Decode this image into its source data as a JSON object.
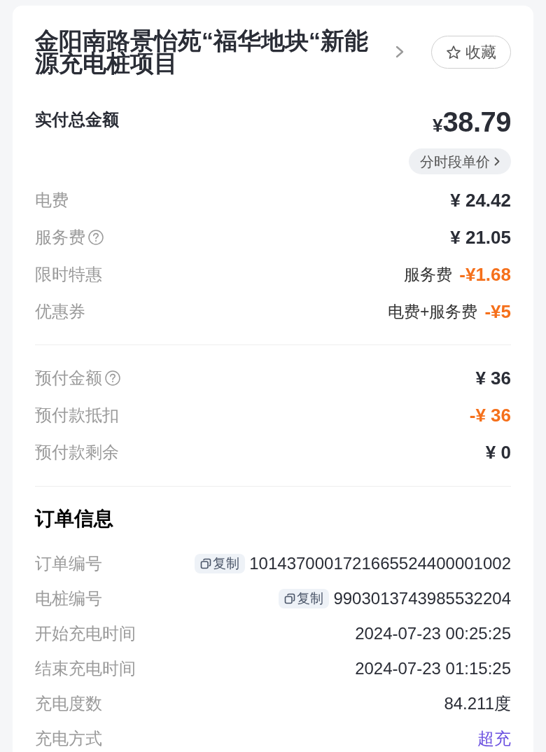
{
  "header": {
    "title": "金阳南路景怡苑“福华地块“新能源充电桩项目",
    "favorite_button": "收藏"
  },
  "total": {
    "label": "实付总金额",
    "currency": "¥",
    "amount": "38.79",
    "price_button": "分时段单价"
  },
  "fees": [
    {
      "label": "电费",
      "help": false,
      "kind": "charge",
      "value": "¥ 24.42"
    },
    {
      "label": "服务费",
      "help": true,
      "kind": "charge",
      "value": "¥ 21.05"
    },
    {
      "label": "限时特惠",
      "help": false,
      "kind": "discount",
      "note": "服务费",
      "value": "-¥1.68"
    },
    {
      "label": "优惠券",
      "help": false,
      "kind": "discount",
      "note": "电费+服务费",
      "value": "-¥5"
    }
  ],
  "prepay": [
    {
      "label": "预付金额",
      "help": true,
      "kind": "charge",
      "value": "¥ 36"
    },
    {
      "label": "预付款抵扣",
      "help": false,
      "kind": "discount",
      "value": "-¥ 36"
    },
    {
      "label": "预付款剩余",
      "help": false,
      "kind": "charge",
      "value": "¥ 0"
    }
  ],
  "order_info": {
    "title": "订单信息",
    "rows": [
      {
        "label": "订单编号",
        "kind": "copyable",
        "copy_button": "复制",
        "value": "1014370001721665524400001002"
      },
      {
        "label": "电桩编号",
        "kind": "copyable",
        "copy_button": "复制",
        "value": "9903013743985532204"
      },
      {
        "label": "开始充电时间",
        "kind": "plain",
        "value": "2024-07-23 00:25:25"
      },
      {
        "label": "结束充电时间",
        "kind": "plain",
        "value": "2024-07-23 01:15:25"
      },
      {
        "label": "充电度数",
        "kind": "plain",
        "value": "84.211度"
      },
      {
        "label": "充电方式",
        "kind": "accent",
        "value": "超充"
      }
    ]
  }
}
